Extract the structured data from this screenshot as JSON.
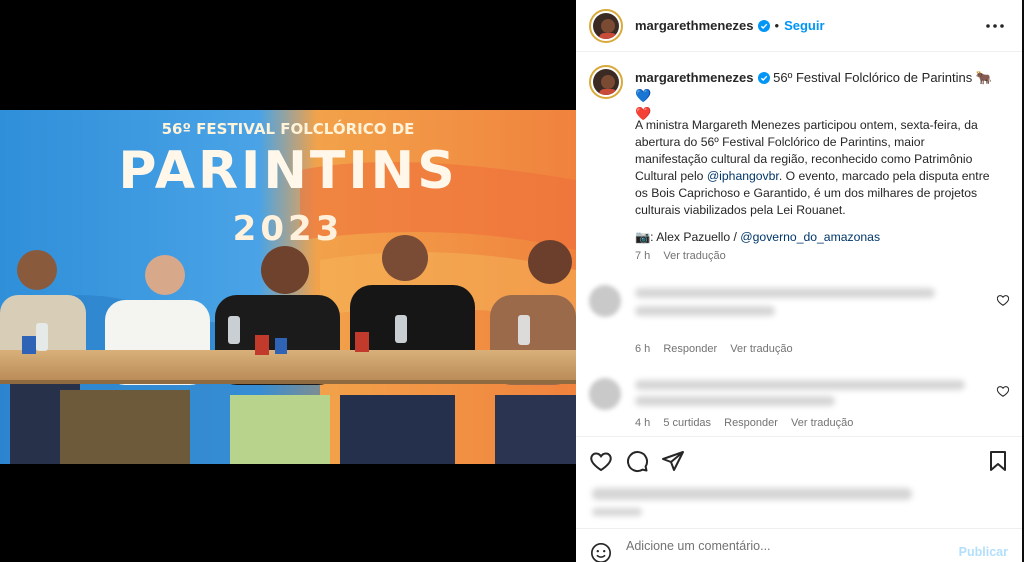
{
  "post": {
    "username": "margarethmenezes",
    "follow_label": "Seguir",
    "dot": "•",
    "more_icon": "more-horizontal-icon"
  },
  "photo": {
    "banner_top": "56º FESTIVAL FOLCLÓRICO DE",
    "banner_big": "PARINTINS",
    "banner_year": "2023"
  },
  "caption": {
    "username": "margarethmenezes",
    "title": "56º Festival Folclórico de Parintins 🐂💙",
    "title_heart": "❤️",
    "body_pre": "A ministra Margareth Menezes participou ontem, sexta-feira, da abertura do 56º Festival Folclórico de Parintins, maior manifestação cultural da região, reconhecido como Patrimônio Cultural pelo ",
    "body_mention": "@iphangovbr",
    "body_post": ". O evento, marcado pela disputa entre os Bois Caprichoso e Garantido, é um dos milhares de projetos culturais viabilizados pela Lei Rouanet.",
    "credit_pre": "📷: Alex Pazuello / ",
    "credit_mention": "@governo_do_amazonas",
    "time": "7 h",
    "see_translation": "Ver tradução"
  },
  "comments": [
    {
      "time": "6 h",
      "reply": "Responder",
      "translate": "Ver tradução"
    },
    {
      "time": "4 h",
      "likes": "5 curtidas",
      "reply": "Responder",
      "translate": "Ver tradução"
    }
  ],
  "add_comment": {
    "placeholder": "Adicione um comentário...",
    "publish_label": "Publicar"
  },
  "colors": {
    "link": "#0095f6",
    "mention": "#00376b",
    "muted": "#737373",
    "publish_disabled": "#b2dffc",
    "heart": "#ed4956"
  }
}
